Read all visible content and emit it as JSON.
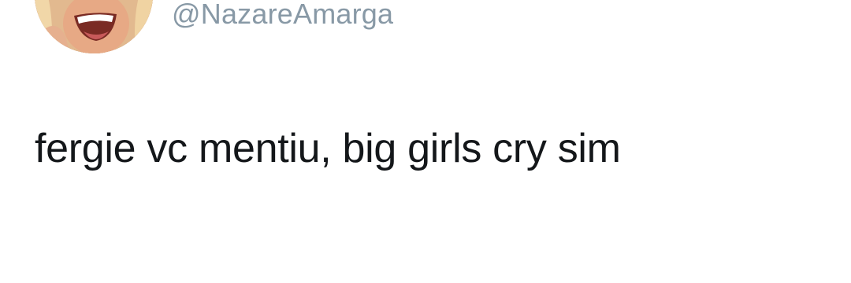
{
  "author": {
    "handle": "@NazareAmarga",
    "avatar_icon": "profile-photo"
  },
  "tweet": {
    "text": "fergie vc mentiu, big girls cry sim"
  },
  "colors": {
    "background": "#ffffff",
    "handle": "#8899a6",
    "text": "#14171a"
  }
}
